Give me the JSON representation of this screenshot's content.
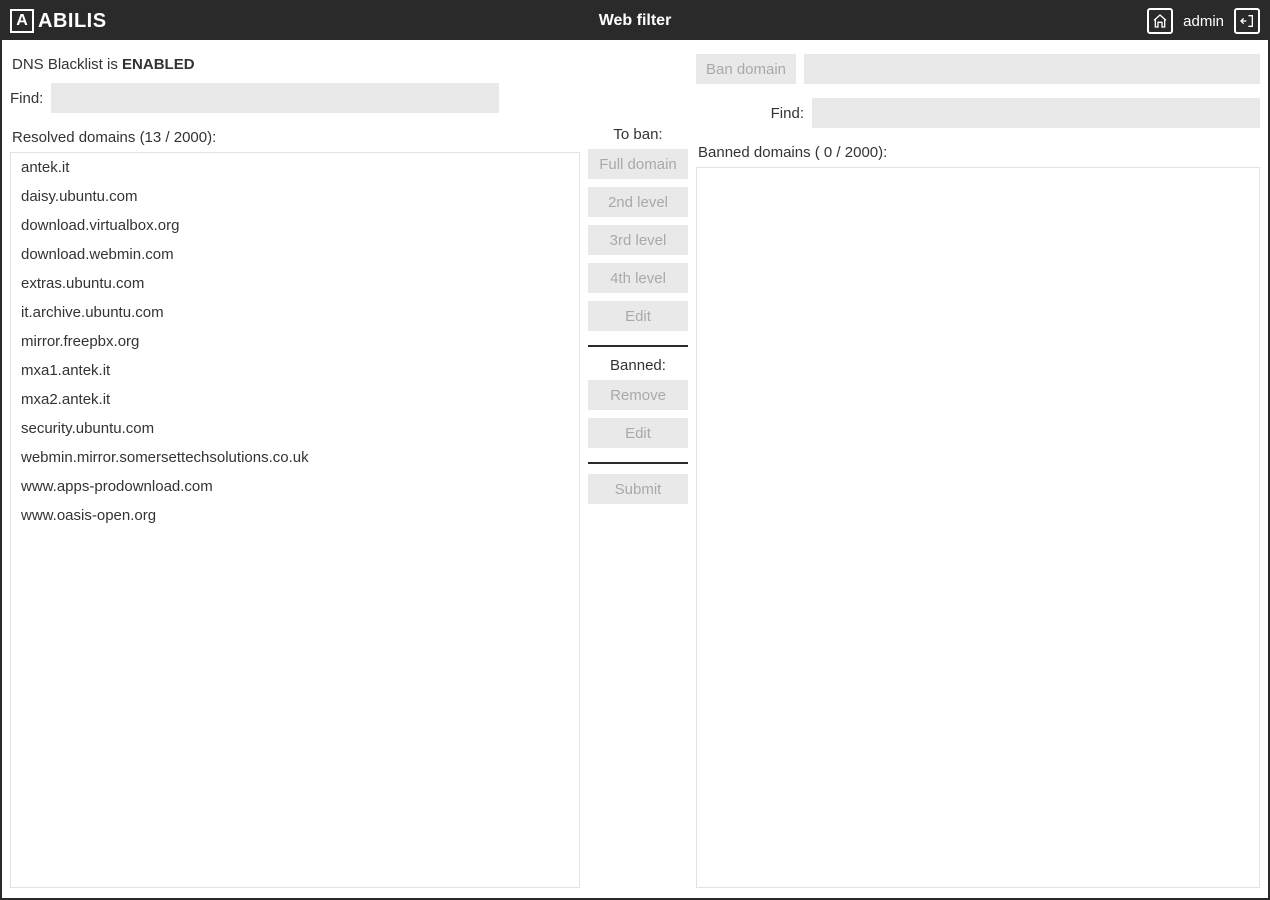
{
  "header": {
    "brand": "ABILIS",
    "brand_letter": "A",
    "title": "Web filter",
    "user": "admin"
  },
  "status": {
    "prefix": "DNS Blacklist is ",
    "state": "ENABLED"
  },
  "left": {
    "find_label": "Find:",
    "find_value": "",
    "list_title": "Resolved domains (13 / 2000):",
    "items": [
      "antek.it",
      "daisy.ubuntu.com",
      "download.virtualbox.org",
      "download.webmin.com",
      "extras.ubuntu.com",
      "it.archive.ubuntu.com",
      "mirror.freepbx.org",
      "mxa1.antek.it",
      "mxa2.antek.it",
      "security.ubuntu.com",
      "webmin.mirror.somersettechsolutions.co.uk",
      "www.apps-prodownload.com",
      "www.oasis-open.org"
    ]
  },
  "mid": {
    "to_ban_label": "To ban:",
    "btn_full": "Full domain",
    "btn_2nd": "2nd level",
    "btn_3rd": "3rd level",
    "btn_4th": "4th level",
    "btn_edit": "Edit",
    "banned_label": "Banned:",
    "btn_remove": "Remove",
    "btn_edit2": "Edit",
    "btn_submit": "Submit"
  },
  "right": {
    "ban_button": "Ban domain",
    "ban_value": "",
    "find_label": "Find:",
    "find_value": "",
    "list_title": "Banned domains ( 0  / 2000):",
    "items": []
  }
}
